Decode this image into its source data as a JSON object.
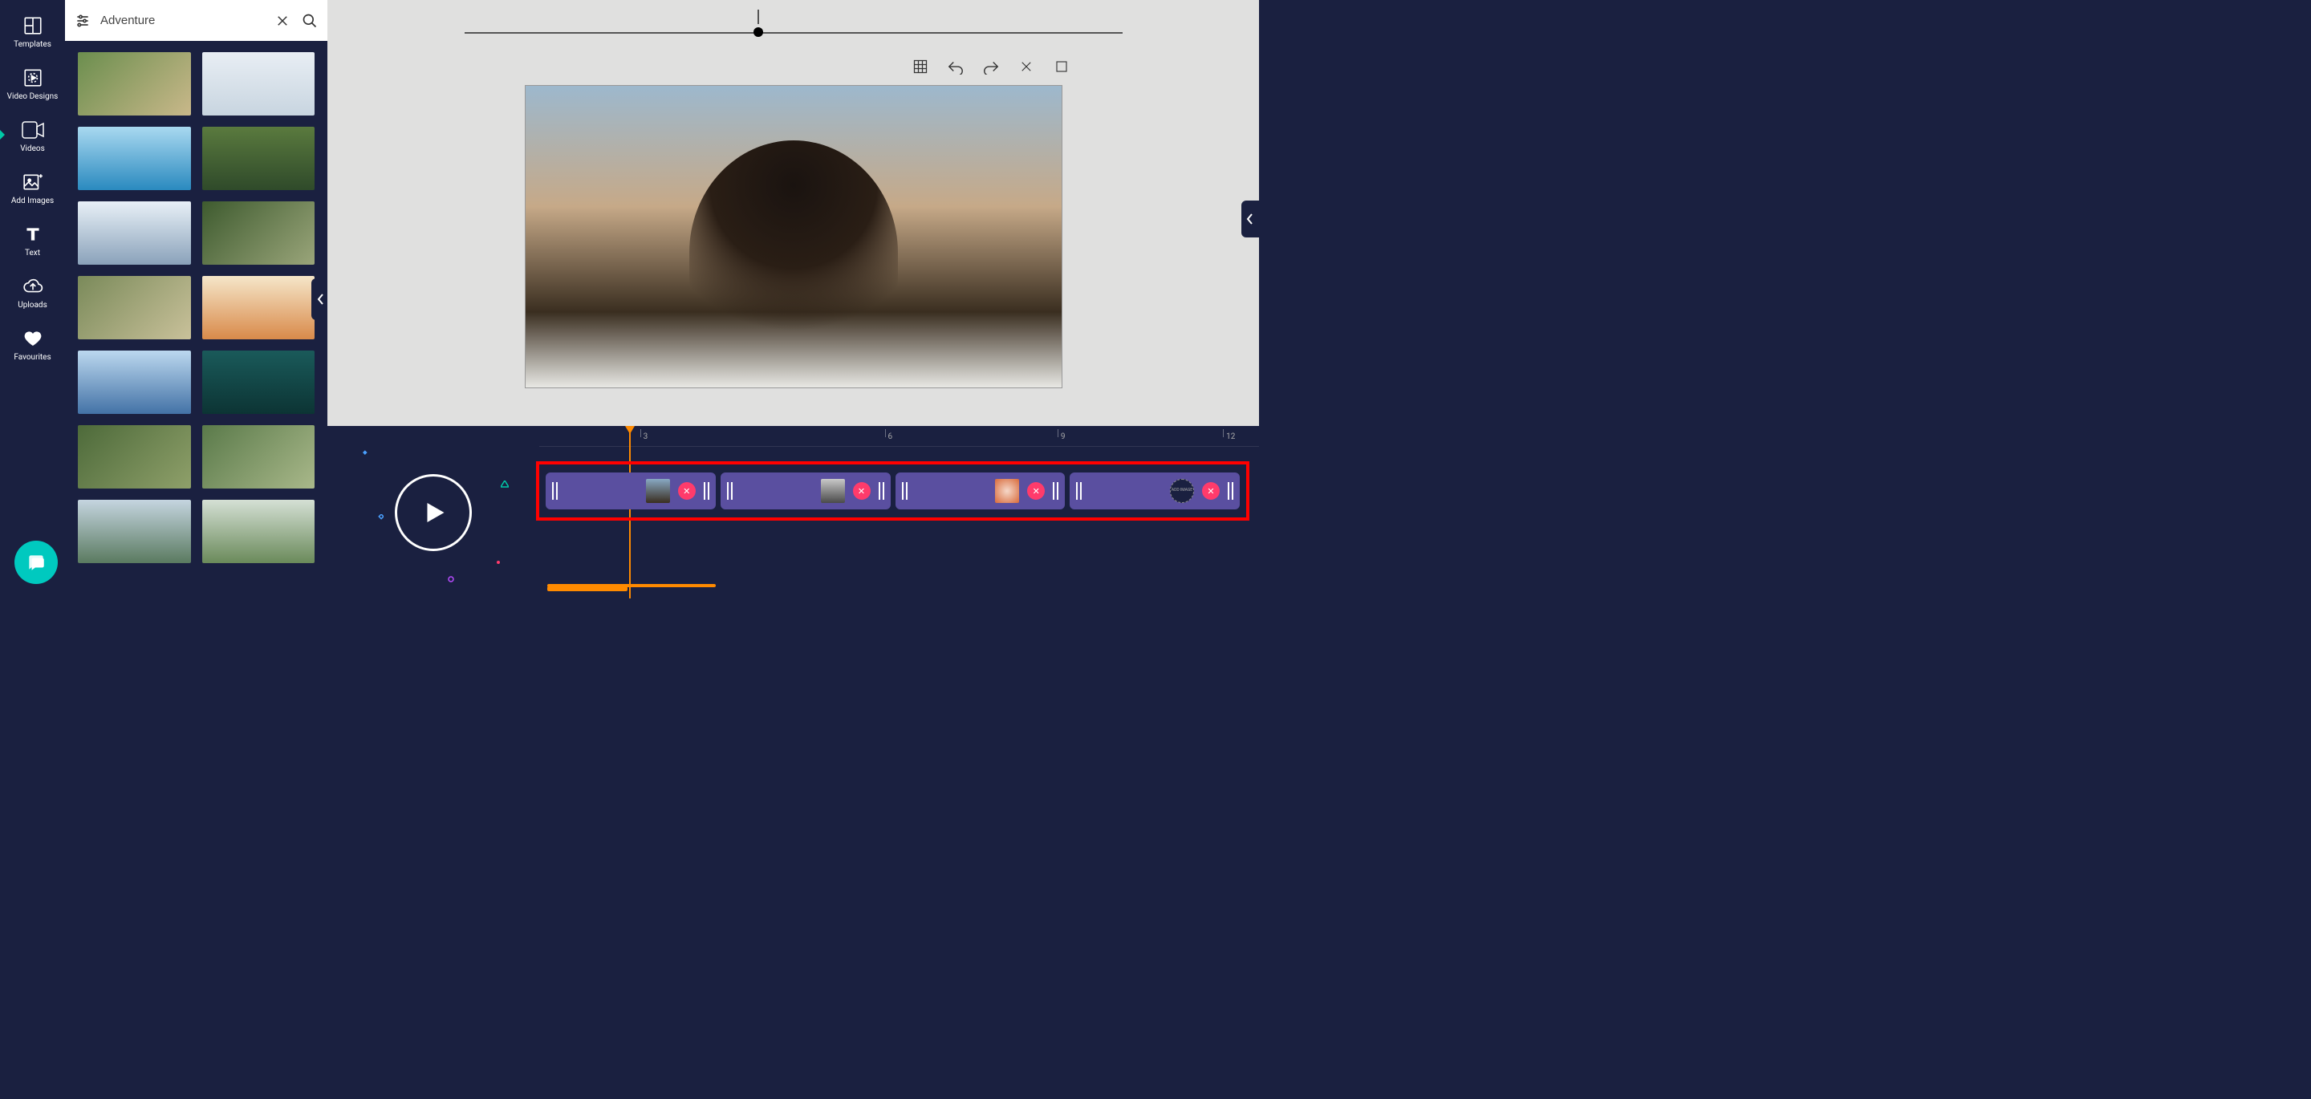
{
  "sidebar": {
    "items": [
      {
        "label": "Templates",
        "icon": "templates-icon"
      },
      {
        "label": "Video Designs",
        "icon": "video-designs-icon"
      },
      {
        "label": "Videos",
        "icon": "videos-icon",
        "active": true
      },
      {
        "label": "Add Images",
        "icon": "add-images-icon"
      },
      {
        "label": "Text",
        "icon": "text-icon"
      },
      {
        "label": "Uploads",
        "icon": "uploads-icon"
      },
      {
        "label": "Favourites",
        "icon": "favourites-icon"
      }
    ]
  },
  "search": {
    "value": "Adventure",
    "filter_icon": "filter-icon",
    "clear_icon": "close-icon",
    "search_icon": "search-icon"
  },
  "results": {
    "count": 14
  },
  "toolbar": {
    "grid": "grid-icon",
    "undo": "undo-icon",
    "redo": "redo-icon",
    "delete": "close-icon",
    "stop": "stop-icon"
  },
  "timeline": {
    "markers": [
      3,
      6,
      9,
      12
    ],
    "playhead_seconds": 1.6,
    "clips": [
      {
        "thumb": "city"
      },
      {
        "thumb": "road"
      },
      {
        "thumb": "flower"
      },
      {
        "thumb": "add",
        "label": "ADD IMAGE"
      }
    ],
    "highlight_box": true
  },
  "chat": {
    "icon": "chat-icon"
  },
  "right_tab": {
    "icon": "chevron-left-icon"
  }
}
